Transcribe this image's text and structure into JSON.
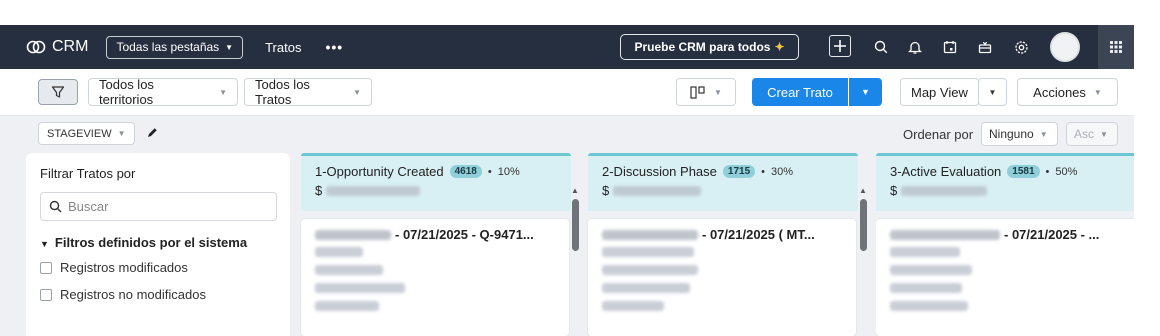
{
  "topbar": {
    "app_name": "CRM",
    "all_tabs_label": "Todas las pestañas",
    "active_tab": "Tratos",
    "more_label": "•••",
    "trial_label": "Pruebe CRM para todos",
    "icons": [
      "plus-icon",
      "search-icon",
      "bell-icon",
      "calendar-icon",
      "gift-icon",
      "gear-icon",
      "avatar",
      "grid-icon"
    ]
  },
  "toolbar": {
    "territory": "Todos los territorios",
    "view": "Todos los Tratos",
    "create_label": "Crear Trato",
    "map_view": "Map View",
    "actions": "Acciones"
  },
  "board": {
    "stageview": "STAGEVIEW",
    "sort_label": "Ordenar por",
    "sort_value": "Ninguno",
    "order_value": "Asc"
  },
  "filter_panel": {
    "title": "Filtrar Tratos por",
    "search_placeholder": "Buscar",
    "system_filters": "Filtros definidos por el sistema",
    "options": [
      "Registros modificados",
      "Registros no modificados"
    ]
  },
  "columns": [
    {
      "title": "1-Opportunity Created",
      "count": "4618",
      "dot": "•",
      "percent": "10%",
      "currency": "$",
      "card_title": "- 07/21/2025 - Q-9471..."
    },
    {
      "title": "2-Discussion Phase",
      "count": "1715",
      "dot": "•",
      "percent": "30%",
      "currency": "$",
      "card_title": "- 07/21/2025 ( MT..."
    },
    {
      "title": "3-Active Evaluation",
      "count": "1581",
      "dot": "•",
      "percent": "50%",
      "currency": "$",
      "card_title": "- 07/21/2025 - ..."
    }
  ],
  "colors": {
    "topbar_bg": "#262f3f",
    "primary_blue": "#1a86e8",
    "stage_header_bg": "#d8f0f4",
    "stage_accent": "#6bc6d2",
    "board_bg": "#eef0f4"
  }
}
